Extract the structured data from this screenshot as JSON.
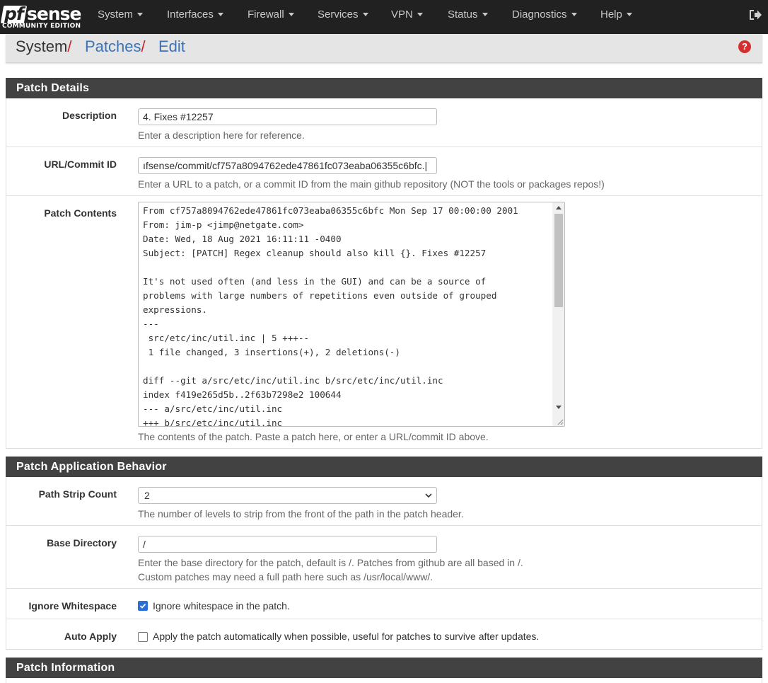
{
  "brand": {
    "pf": "pf",
    "sense": "sense",
    "edition": "COMMUNITY EDITION"
  },
  "nav": {
    "items": [
      "System",
      "Interfaces",
      "Firewall",
      "Services",
      "VPN",
      "Status",
      "Diagnostics",
      "Help"
    ],
    "logout_icon": "sign-out-icon"
  },
  "breadcrumb": {
    "system": "System",
    "patches": "Patches",
    "edit": "Edit",
    "separator": "/",
    "help_icon": "question-circle-icon",
    "help_glyph": "?"
  },
  "panels": {
    "details": {
      "title": "Patch Details",
      "description": {
        "label": "Description",
        "value": "4. Fixes #12257",
        "hint": "Enter a description here for reference."
      },
      "url": {
        "label": "URL/Commit ID",
        "value": "ıfsense/commit/cf757a8094762ede47861fc073eaba06355c6bfc.|",
        "hint": "Enter a URL to a patch, or a commit ID from the main github repository (NOT the tools or packages repos!)"
      },
      "contents": {
        "label": "Patch Contents",
        "lines": [
          "From cf757a8094762ede47861fc073eaba06355c6bfc Mon Sep 17 00:00:00 2001",
          "From: jim-p <jimp@netgate.com>",
          "Date: Wed, 18 Aug 2021 16:11:11 -0400",
          "Subject: [PATCH] Regex cleanup should also kill {}. Fixes #12257",
          "",
          "It's not used often (and less in the GUI) and can be a source of",
          "problems with large numbers of repetitions even outside of grouped",
          "expressions.",
          "---",
          " src/etc/inc/util.inc | 5 +++--",
          " 1 file changed, 3 insertions(+), 2 deletions(-)",
          "",
          "diff --git a/src/etc/inc/util.inc b/src/etc/inc/util.inc",
          "index f419e265d5b..2f63b7298e2 100644",
          "--- a/src/etc/inc/util.inc",
          "+++ b/src/etc/inc/util.inc"
        ],
        "hint": "The contents of the patch. Paste a patch here, or enter a URL/commit ID above."
      }
    },
    "behavior": {
      "title": "Patch Application Behavior",
      "strip": {
        "label": "Path Strip Count",
        "value": "2",
        "hint": "The number of levels to strip from the front of the path in the patch header."
      },
      "basedir": {
        "label": "Base Directory",
        "value": "/",
        "hint1": "Enter the base directory for the patch, default is /. Patches from github are all based in /.",
        "hint2": "Custom patches may need a full path here such as /usr/local/www/."
      },
      "whitespace": {
        "label": "Ignore Whitespace",
        "checked": true,
        "text": "Ignore whitespace in the patch."
      },
      "autoapply": {
        "label": "Auto Apply",
        "checked": false,
        "text": "Apply the patch automatically when possible, useful for patches to survive after updates."
      }
    },
    "info": {
      "title": "Patch Information"
    }
  }
}
